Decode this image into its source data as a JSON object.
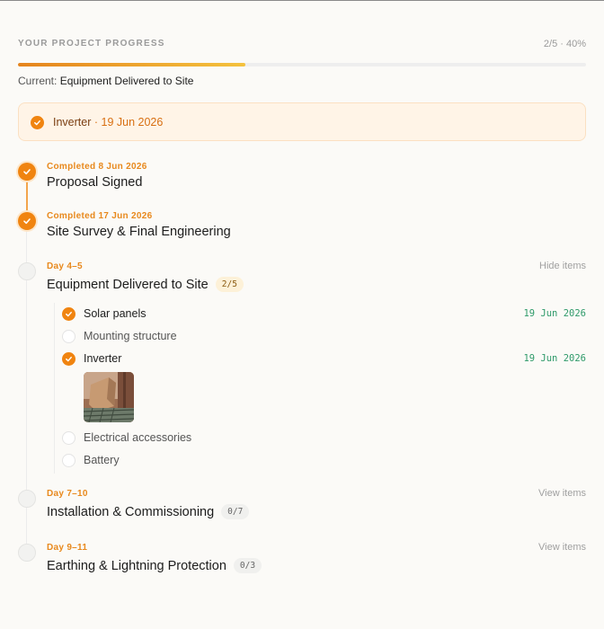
{
  "header": {
    "title": "YOUR PROJECT PROGRESS",
    "stat": "2/5 · 40%",
    "progress_fraction": 0.4
  },
  "current": {
    "prefix": "Current:",
    "value": "Equipment Delivered to Site"
  },
  "notice": {
    "item": "Inverter",
    "separator": " · ",
    "date": "19 Jun 2026"
  },
  "steps": [
    {
      "meta": "Completed 8 Jun 2026",
      "title": "Proposal Signed",
      "status": "done"
    },
    {
      "meta": "Completed 17 Jun 2026",
      "title": "Site Survey & Final Engineering",
      "status": "done"
    },
    {
      "meta": "Day 4–5",
      "title": "Equipment Delivered to Site",
      "badge": "2/5",
      "toggle": "Hide items",
      "status": "current",
      "items": [
        {
          "label": "Solar panels",
          "done": true,
          "date": "19 Jun 2026"
        },
        {
          "label": "Mounting structure",
          "done": false
        },
        {
          "label": "Inverter",
          "done": true,
          "date": "19 Jun 2026",
          "photo": "inverter-photo"
        },
        {
          "label": "Electrical accessories",
          "done": false
        },
        {
          "label": "Battery",
          "done": false
        }
      ]
    },
    {
      "meta": "Day 7–10",
      "title": "Installation & Commissioning",
      "badge": "0/7",
      "toggle": "View items",
      "status": "pending"
    },
    {
      "meta": "Day 9–11",
      "title": "Earthing & Lightning Protection",
      "badge": "0/3",
      "toggle": "View items",
      "status": "pending"
    }
  ],
  "colors": {
    "accent": "#f08410",
    "progress_start": "#e5841d",
    "progress_end": "#f4c23e",
    "date_green": "#2f9a6a",
    "notice_bg": "#fff4e7"
  }
}
